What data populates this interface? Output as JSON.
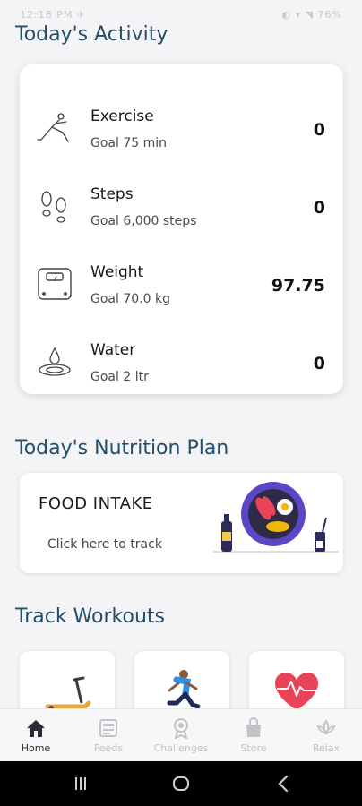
{
  "status_bar": {
    "left": "12:18 PM ✈",
    "right": "◐ ▾ ◥ 76%"
  },
  "activity": {
    "title": "Today's Activity",
    "items": [
      {
        "name": "Exercise",
        "goal": "Goal 75 min",
        "value": "0",
        "icon": "exercise-icon"
      },
      {
        "name": "Steps",
        "goal": "Goal 6,000 steps",
        "value": "0",
        "icon": "footsteps-icon"
      },
      {
        "name": "Weight",
        "goal": "Goal 70.0 kg",
        "value": "97.75",
        "icon": "scale-icon"
      },
      {
        "name": "Water",
        "goal": "Goal 2 ltr",
        "value": "0",
        "icon": "water-drop-icon"
      }
    ]
  },
  "nutrition": {
    "title": "Today's Nutrition Plan",
    "card_title": "FOOD INTAKE",
    "card_subtitle": "Click here to track"
  },
  "workouts": {
    "title": "Track Workouts",
    "cards": [
      {
        "icon": "treadmill-icon"
      },
      {
        "icon": "runner-icon"
      },
      {
        "icon": "heart-pulse-icon"
      }
    ]
  },
  "bottom_nav": {
    "items": [
      {
        "label": "Home",
        "icon": "home-icon",
        "active": true
      },
      {
        "label": "Feeds",
        "icon": "feeds-icon",
        "active": false
      },
      {
        "label": "Challenges",
        "icon": "medal-icon",
        "active": false
      },
      {
        "label": "Store",
        "icon": "shopping-bag-icon",
        "active": false
      },
      {
        "label": "Relax",
        "icon": "lotus-icon",
        "active": false
      }
    ]
  },
  "colors": {
    "heading": "#214e6c",
    "background": "#f4f4f6",
    "card": "#ffffff",
    "accent_purple": "#5b46c8",
    "heart_red": "#e9435a"
  }
}
